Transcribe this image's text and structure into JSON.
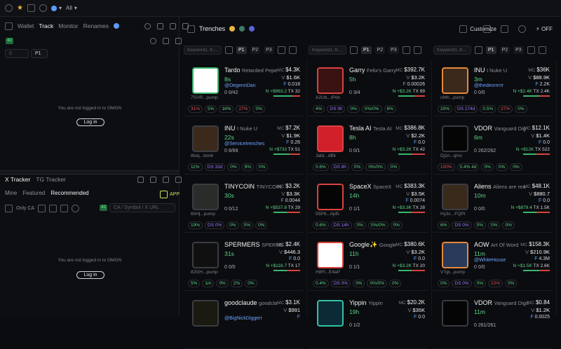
{
  "topbar": {
    "all_label": "All"
  },
  "left": {
    "tabs": [
      "Wallet",
      "Track",
      "Monitor",
      "Renames"
    ],
    "badge": "42",
    "filter_placeholder": "0",
    "p1": "P1",
    "not_logged": "You are not logged in to GMGN",
    "login": "Log in",
    "xtabs": [
      "X Tracker",
      "TG Tracker"
    ],
    "subtabs": [
      "Mine",
      "Featured",
      "Recommended"
    ],
    "app": "APP",
    "only_ca": "Only CA",
    "search_placeholder": "CA / Symbol / X URL",
    "badge2": "42"
  },
  "main": {
    "title": "Trenches",
    "customize": "Customize",
    "off": "OFF",
    "kw_placeholder": "Keyword1, K...",
    "pills": [
      "P1",
      "P2",
      "P3"
    ]
  },
  "columns": [
    {
      "cards": [
        {
          "name": "Tardo",
          "ticker": "Retarded Pepe",
          "age": "8s",
          "handle": "@DegennDan",
          "stats": "0 0/42",
          "mc": "$4.3K",
          "v": "$1.6K",
          "f": "0.018",
          "n": "+$963.2",
          "tx": "32",
          "addr": "7SVR...pump",
          "avclass": "green",
          "avbg": "#ffffff",
          "bar": 0.7,
          "badges": [
            [
              "31%",
              "r"
            ],
            [
              "5%",
              "g"
            ],
            [
              "16%",
              "g"
            ],
            [
              "27%",
              "r"
            ],
            [
              "0%",
              "g"
            ]
          ]
        },
        {
          "name": "INU",
          "ticker": "I Nuke U",
          "age": "22s",
          "handle": "@Servicetrenches",
          "stats": "0 8/68",
          "mc": "$7.2K",
          "v": "$1.9K",
          "f": "0.26",
          "n": "+$733",
          "tx": "51",
          "addr": "8toq...bonk",
          "avclass": "",
          "avbg": "#3b2a1c",
          "bar": 0.6,
          "badges": [
            [
              "11%",
              "g"
            ],
            [
              "DS 33d",
              "p"
            ],
            [
              "0%",
              "g"
            ],
            [
              "9%",
              "g"
            ],
            [
              "0%",
              "g"
            ]
          ]
        },
        {
          "name": "TINYCOIN",
          "ticker": "TINYCOIN",
          "age": "30s",
          "handle": "",
          "stats": "0 0/12",
          "mc": "$3.2K",
          "v": "$3.3K",
          "f": "0.0044",
          "n": "+$537.8",
          "tx": "29",
          "addr": "6hHj...pump",
          "avclass": "",
          "avbg": "#2a2c2a",
          "bar": 0.5,
          "badges": [
            [
              "19%",
              "g"
            ],
            [
              "DS 0%",
              "p"
            ],
            [
              "0%",
              "g"
            ],
            [
              "0%",
              "g"
            ],
            [
              "0%",
              "g"
            ]
          ]
        },
        {
          "name": "SPERMERS",
          "ticker": "SPERME",
          "age": "31s",
          "handle": "",
          "stats": "0 0/0",
          "mc": "$2.4K",
          "v": "$446.3",
          "f": "0.0",
          "n": "+$118.7",
          "tx": "17",
          "addr": "82GH...pump",
          "avclass": "",
          "avbg": "#101010",
          "bar": 0.5,
          "badges": [
            [
              "5%",
              "g"
            ],
            [
              "1m",
              "g"
            ],
            [
              "0%",
              "g"
            ],
            [
              "2%",
              "g"
            ],
            [
              "0%",
              "g"
            ]
          ]
        },
        {
          "name": "goodclaude",
          "ticker": "goodcla",
          "age": "",
          "handle": "@BigNickDiggerr",
          "stats": "",
          "mc": "$3.1K",
          "v": "$991",
          "f": "",
          "n": "",
          "tx": "",
          "addr": "",
          "avclass": "",
          "avbg": "#1a1a10",
          "bar": 0.5,
          "badges": []
        }
      ]
    },
    {
      "cards": [
        {
          "name": "Garry",
          "ticker": "Felix's Garry",
          "age": "5h",
          "handle": "",
          "stats": "0 3/4",
          "mc": "$392.7K",
          "v": "$3.2K",
          "f": "0.00026",
          "n": "+$3.2K",
          "tx": "99",
          "addr": "A2Ub...rPdx",
          "avclass": "red",
          "avbg": "#3a1212",
          "bar": 0.6,
          "badges": [
            [
              "4%",
              "g"
            ],
            [
              "DS 9h",
              "p"
            ],
            [
              "0%",
              "g"
            ],
            [
              "0%/0%",
              "g"
            ],
            [
              "6%",
              "g"
            ]
          ]
        },
        {
          "name": "Tesla AI",
          "ticker": "Tesla AI",
          "age": "8h",
          "handle": "",
          "stats": "0 0/1",
          "mc": "$386.8K",
          "v": "$2.2K",
          "f": "0.0",
          "n": "+$3.2K",
          "tx": "42",
          "addr": "Jatd...dBk",
          "avclass": "red",
          "avbg": "#d2202b",
          "bar": 0.5,
          "badges": [
            [
              "0.6%",
              "g"
            ],
            [
              "DS 8h",
              "p"
            ],
            [
              "0%",
              "g"
            ],
            [
              "0%/0%",
              "g"
            ],
            [
              "0%",
              "g"
            ]
          ]
        },
        {
          "name": "SpaceX",
          "ticker": "SpaceX",
          "age": "14h",
          "handle": "",
          "stats": "0 1/1",
          "mc": "$383.3K",
          "v": "$3.5K",
          "f": "0.0074",
          "n": "+$3.3K",
          "tx": "28",
          "addr": "55P9...Ajd5",
          "avclass": "red",
          "avbg": "#050505",
          "bar": 0.5,
          "badges": [
            [
              "0.6%",
              "g"
            ],
            [
              "DS 14h",
              "p"
            ],
            [
              "0%",
              "g"
            ],
            [
              "0%/0%",
              "g"
            ],
            [
              "0%",
              "g"
            ]
          ]
        },
        {
          "name": "Google✨",
          "ticker": "Google",
          "age": "11h",
          "handle": "",
          "stats": "0 1/1",
          "mc": "$380.6K",
          "v": "$3.2K",
          "f": "0.0",
          "n": "+$3.2K",
          "tx": "20",
          "addr": "H8fY...E4aP",
          "avclass": "red",
          "avbg": "#ffffff",
          "bar": 0.5,
          "badges": [
            [
              "0.4%",
              "g"
            ],
            [
              "DS 0%",
              "p"
            ],
            [
              "0%",
              "g"
            ],
            [
              "0%/0%",
              "g"
            ],
            [
              "0%",
              "g"
            ]
          ]
        },
        {
          "name": "Yippin",
          "ticker": "Yippin",
          "age": "19h",
          "handle": "",
          "stats": "0 1/2",
          "mc": "$20.2K",
          "v": "$35K",
          "f": "0.0",
          "n": "",
          "tx": "",
          "addr": "",
          "avclass": "teal",
          "avbg": "#0c2a36",
          "bar": 0.5,
          "badges": []
        }
      ]
    },
    {
      "cards": [
        {
          "name": "INU",
          "ticker": "I Nuke U",
          "age": "3m",
          "handle": "@thedevrrrrrr",
          "stats": "0 0/0",
          "mc": "$36K",
          "v": "$88.9K",
          "f": "2.2K",
          "n": "+$2.4K",
          "tx": "2.4K",
          "addr": "ohth...pump",
          "avclass": "orange",
          "avbg": "#3b2a1c",
          "bar": 0.6,
          "badges": [
            [
              "20%",
              "g"
            ],
            [
              "DS 274d",
              "p"
            ],
            [
              "0.5%",
              "g"
            ],
            [
              "27%",
              "r"
            ],
            [
              "0%",
              "g"
            ]
          ]
        },
        {
          "name": "VDOR",
          "ticker": "Vanguard Dig",
          "age": "6m",
          "handle": "",
          "stats": "0 262/262",
          "mc": "$12.1K",
          "v": "$1.4K",
          "f": "0.0",
          "n": "+$12K",
          "tx": "522",
          "addr": "Dj1n...qmx",
          "avclass": "",
          "avbg": "#050505",
          "bar": 0.5,
          "badges": [
            [
              "100%",
              "r"
            ],
            [
              "0.4% 4d",
              "g"
            ],
            [
              "0%",
              "g"
            ],
            [
              "0%",
              "g"
            ],
            [
              "0%",
              "g"
            ]
          ]
        },
        {
          "name": "Aliens",
          "ticker": "Aliens are rea",
          "age": "10m",
          "handle": "",
          "stats": "0 0/0",
          "mc": "$48.1K",
          "v": "$880.7",
          "f": "0.0",
          "n": "+$879.4",
          "tx": "1.5K",
          "addr": "Hy3c...FQPt",
          "avclass": "",
          "avbg": "#3a2a1c",
          "bar": 0.5,
          "badges": [
            [
              "6%",
              "g"
            ],
            [
              "DS 0%",
              "p"
            ],
            [
              "0%",
              "g"
            ],
            [
              "0%",
              "g"
            ],
            [
              "0%",
              "g"
            ]
          ]
        },
        {
          "name": "AOW",
          "ticker": "Art Of Word",
          "age": "11m",
          "handle": "@WhiteHouse",
          "stats": "0 0/0",
          "mc": "$158.3K",
          "v": "$210.9K",
          "f": "4.3M",
          "n": "+$1.5K",
          "tx": "2.6K",
          "addr": "V7gt...pump",
          "avclass": "orange",
          "avbg": "#2a3a5a",
          "bar": 0.6,
          "badges": [
            [
              "0%",
              "g"
            ],
            [
              "DS 0%",
              "p"
            ],
            [
              "0%",
              "g"
            ],
            [
              "22%",
              "r"
            ],
            [
              "0%",
              "g"
            ]
          ]
        },
        {
          "name": "VDOR",
          "ticker": "Vanguard Digit",
          "age": "11m",
          "handle": "",
          "stats": "0 261/261",
          "mc": "$0.84",
          "v": "$1.2K",
          "f": "0.0025",
          "n": "",
          "tx": "",
          "addr": "",
          "avclass": "",
          "avbg": "#050505",
          "bar": 0.5,
          "badges": []
        }
      ]
    }
  ]
}
